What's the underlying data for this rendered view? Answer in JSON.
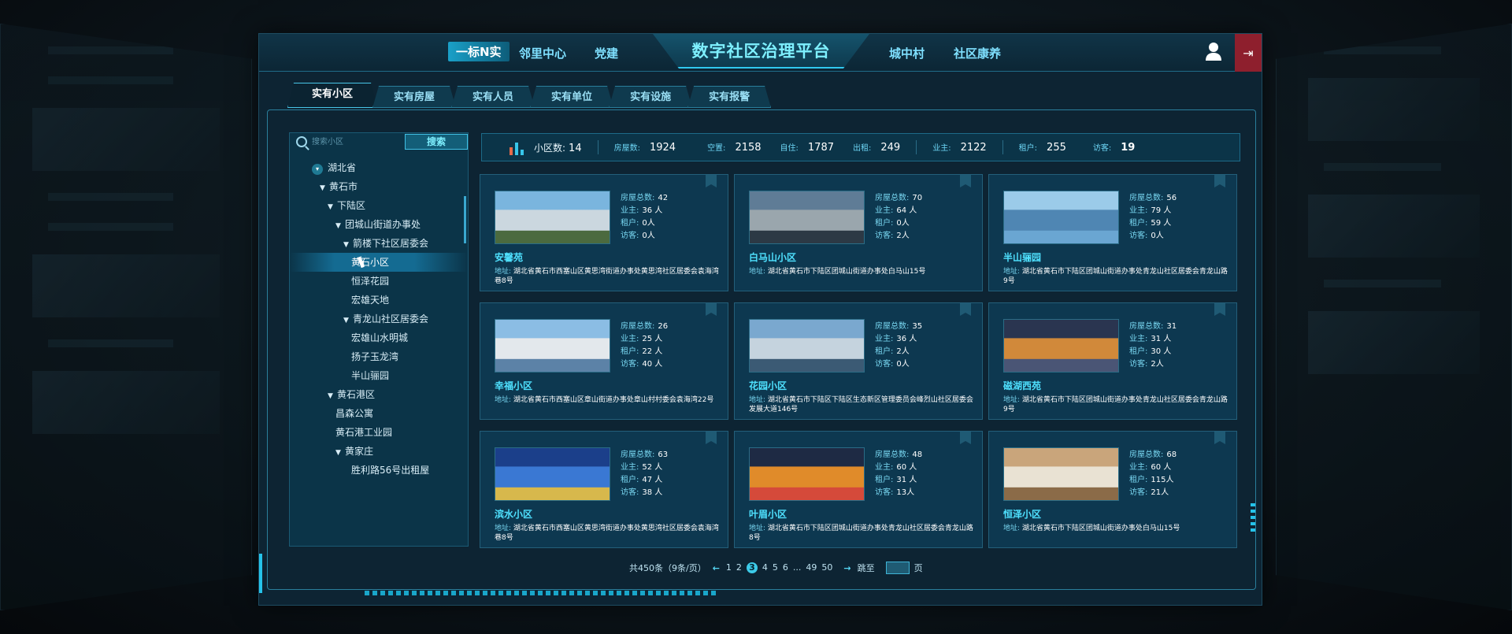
{
  "header": {
    "nav_left": [
      "一标N实",
      "邻里中心",
      "党建"
    ],
    "title": "数字社区治理平台",
    "nav_right": [
      "城中村",
      "社区康养"
    ],
    "logout_label": "⇥"
  },
  "tabs": [
    "实有小区",
    "实有房屋",
    "实有人员",
    "实有单位",
    "实有设施",
    "实有报警"
  ],
  "search": {
    "placeholder": "搜索小区",
    "button": "搜索"
  },
  "tree": [
    {
      "label": "湖北省",
      "level": 0,
      "kind": "root"
    },
    {
      "label": "黄石市",
      "level": 1,
      "kind": "open"
    },
    {
      "label": "下陆区",
      "level": 2,
      "kind": "open"
    },
    {
      "label": "团城山街道办事处",
      "level": 3,
      "kind": "open"
    },
    {
      "label": "箭楼下社区居委会",
      "level": 4,
      "kind": "open"
    },
    {
      "label": "黄石小区",
      "level": 5,
      "kind": "leaf",
      "selected": true
    },
    {
      "label": "恒泽花园",
      "level": 5,
      "kind": "leaf"
    },
    {
      "label": "宏雄天地",
      "level": 5,
      "kind": "leaf"
    },
    {
      "label": "青龙山社区居委会",
      "level": 4,
      "kind": "open"
    },
    {
      "label": "宏雄山水明城",
      "level": 5,
      "kind": "leaf"
    },
    {
      "label": "扬子玉龙湾",
      "level": 5,
      "kind": "leaf"
    },
    {
      "label": "半山骊园",
      "level": 5,
      "kind": "leaf"
    },
    {
      "label": "黄石港区",
      "level": 2,
      "kind": "open"
    },
    {
      "label": "昌森公寓",
      "level": 3,
      "kind": "leaf"
    },
    {
      "label": "黄石港工业园",
      "level": 3,
      "kind": "leaf"
    },
    {
      "label": "黄家庄",
      "level": 3,
      "kind": "open"
    },
    {
      "label": "胜利路56号出租屋",
      "level": 5,
      "kind": "leaf"
    }
  ],
  "stats": {
    "count_label": "小区数:",
    "count": "14",
    "items": [
      {
        "k": "房屋数:",
        "v": "1924"
      },
      {
        "k": "空置:",
        "v": "2158"
      },
      {
        "k": "自住:",
        "v": "1787"
      },
      {
        "k": "出租:",
        "v": "249"
      },
      {
        "k": "业主:",
        "v": "2122"
      },
      {
        "k": "租户:",
        "v": "255"
      },
      {
        "k": "访客:",
        "v": "19"
      }
    ]
  },
  "labels": {
    "houses": "房屋总数:",
    "owners": "业主:",
    "tenants": "租户:",
    "visitors": "访客:",
    "addr": "地址:"
  },
  "cards": [
    {
      "name": "安馨苑",
      "houses": "42",
      "owners": "36 人",
      "tenants": "0人",
      "visitors": "0人",
      "addr": "湖北省黄石市西塞山区黄思湾街道办事处黄思湾社区居委会袁海湾巷8号",
      "palette": [
        "#7ab5de",
        "#cbd7df",
        "#4b6a3f"
      ]
    },
    {
      "name": "白马山小区",
      "houses": "70",
      "owners": "64 人",
      "tenants": "0人",
      "visitors": "2人",
      "addr": "湖北省黄石市下陆区团城山街道办事处白马山15号",
      "palette": [
        "#5f7c96",
        "#9aa6ad",
        "#2c3945"
      ]
    },
    {
      "name": "半山骊园",
      "houses": "56",
      "owners": "79 人",
      "tenants": "59 人",
      "visitors": "0人",
      "addr": "湖北省黄石市下陆区团城山街道办事处青龙山社区居委会青龙山路9号",
      "palette": [
        "#9bcbe9",
        "#4f86b3",
        "#6aa6d2"
      ]
    },
    {
      "name": "幸福小区",
      "houses": "26",
      "owners": "25 人",
      "tenants": "22 人",
      "visitors": "40 人",
      "addr": "湖北省黄石市西塞山区章山街道办事处章山村村委会袁海湾22号",
      "palette": [
        "#8bbde4",
        "#e3e8ec",
        "#5c82a7"
      ]
    },
    {
      "name": "花园小区",
      "houses": "35",
      "owners": "36 人",
      "tenants": "2人",
      "visitors": "0人",
      "addr": "湖北省黄石市下陆区下陆区生态新区管理委员会峰烈山社区居委会发展大道146号",
      "palette": [
        "#7aa8cf",
        "#c5d3de",
        "#3b5a74"
      ]
    },
    {
      "name": "磁湖西苑",
      "houses": "31",
      "owners": "31 人",
      "tenants": "30 人",
      "visitors": "2人",
      "addr": "湖北省黄石市下陆区团城山街道办事处青龙山社区居委会青龙山路9号",
      "palette": [
        "#2a3550",
        "#d1893a",
        "#4a5575"
      ]
    },
    {
      "name": "滨水小区",
      "houses": "63",
      "owners": "52 人",
      "tenants": "47 人",
      "visitors": "38 人",
      "addr": "湖北省黄石市西塞山区黄思湾街道办事处黄思湾社区居委会袁海湾巷8号",
      "palette": [
        "#1b3f8a",
        "#3a78d3",
        "#d7b84c"
      ]
    },
    {
      "name": "叶眉小区",
      "houses": "48",
      "owners": "60 人",
      "tenants": "31 人",
      "visitors": "13人",
      "addr": "湖北省黄石市下陆区团城山街道办事处青龙山社区居委会青龙山路8号",
      "palette": [
        "#1e2a44",
        "#e08b2a",
        "#d54a3a"
      ]
    },
    {
      "name": "恒泽小区",
      "houses": "68",
      "owners": "60 人",
      "tenants": "115人",
      "visitors": "21人",
      "addr": "湖北省黄石市下陆区团城山街道办事处白马山15号",
      "palette": [
        "#c9a57b",
        "#e9e2d3",
        "#8b6b48"
      ]
    }
  ],
  "pager": {
    "total": "共450条（9条/页）",
    "pages": [
      "1",
      "2",
      "3",
      "4",
      "5",
      "6",
      "...",
      "49",
      "50"
    ],
    "current": "3",
    "jump_label": "跳至",
    "page_suffix": "页"
  }
}
